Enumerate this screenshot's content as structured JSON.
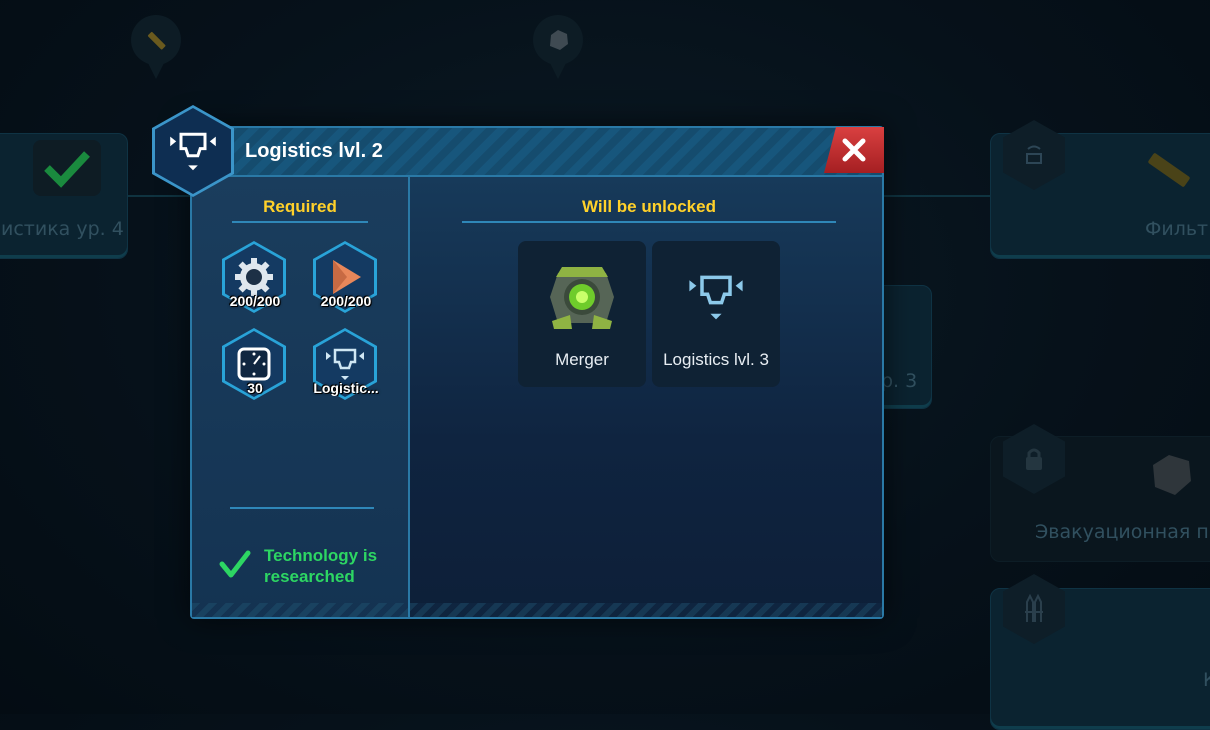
{
  "background": {
    "card_left_text": "истика ур. 4",
    "card_mid_text": "р. 3",
    "card_right_top_text": "Фильт",
    "card_right_mid_text": "Эвакуационная п",
    "card_right_bottom_text": "К",
    "icons": [
      "pencil-pin-icon",
      "rock-pin-icon",
      "checkmark-icon",
      "wifi-hex-icon",
      "lock-hex-icon",
      "rocket-hex-icon",
      "rock-icon",
      "pencil-icon"
    ]
  },
  "dialog": {
    "title": "Logistics lvl. 2",
    "title_icon": "logistics-icon",
    "close_icon": "close-icon",
    "required": {
      "heading": "Required",
      "items": [
        {
          "icon": "gear-icon",
          "label": "200/200"
        },
        {
          "icon": "copper-icon",
          "label": "200/200"
        },
        {
          "icon": "timer-icon",
          "label": "30"
        },
        {
          "icon": "logistics-icon",
          "label": "Logistic..."
        }
      ]
    },
    "status": {
      "icon": "checkmark-icon",
      "text": "Technology is researched",
      "color": "#2dd663"
    },
    "unlocks": {
      "heading": "Will be unlocked",
      "items": [
        {
          "icon": "merger-icon",
          "label": "Merger"
        },
        {
          "icon": "logistics-icon",
          "label": "Logistics lvl. 3"
        }
      ]
    }
  },
  "colors": {
    "heading": "#ffd12a",
    "accent": "#2a79a6",
    "close": "#c62e31"
  }
}
